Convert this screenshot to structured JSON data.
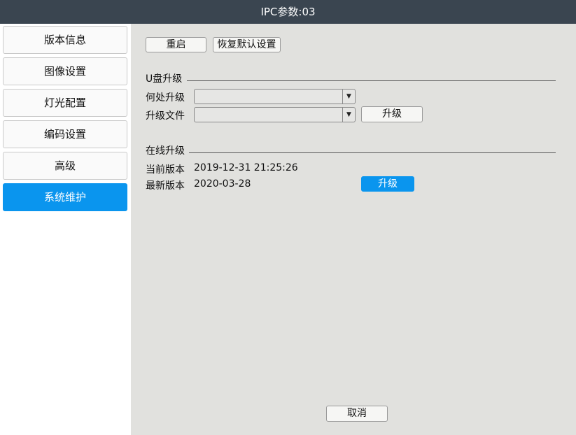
{
  "window": {
    "title": "IPC参数:03"
  },
  "sidebar": {
    "items": [
      {
        "label": "版本信息",
        "active": false
      },
      {
        "label": "图像设置",
        "active": false
      },
      {
        "label": "灯光配置",
        "active": false
      },
      {
        "label": "编码设置",
        "active": false
      },
      {
        "label": "高级",
        "active": false
      },
      {
        "label": "系统维护",
        "active": true
      }
    ]
  },
  "toolbar": {
    "restart_label": "重启",
    "restore_defaults_label": "恢复默认设置"
  },
  "usb_upgrade": {
    "title": "U盘升级",
    "location_label": "何处升级",
    "location_value": "",
    "file_label": "升级文件",
    "file_value": "",
    "upgrade_label": "升级"
  },
  "online_upgrade": {
    "title": "在线升级",
    "current_label": "当前版本",
    "current_value": "2019-12-31 21:25:26",
    "latest_label": "最新版本",
    "latest_value": "2020-03-28",
    "upgrade_label": "升级"
  },
  "footer": {
    "cancel_label": "取消"
  },
  "colors": {
    "titlebar": "#3a4550",
    "accent": "#0a95ee",
    "panel": "#e1e1de",
    "sidebar": "#ffffff"
  }
}
